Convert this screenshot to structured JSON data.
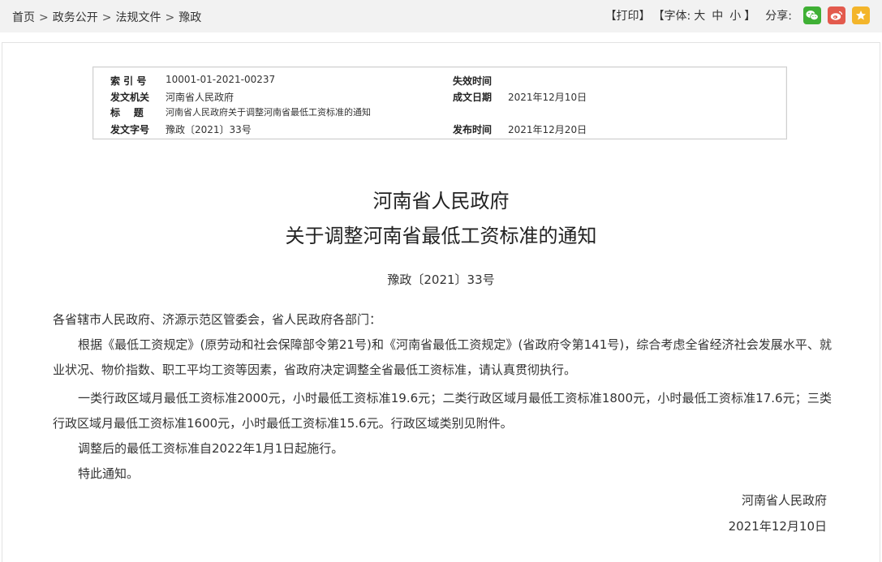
{
  "breadcrumb": {
    "items": [
      "首页",
      "政务公开",
      "法规文件",
      "豫政"
    ],
    "separator": ">"
  },
  "toolbar": {
    "print": "【打印】",
    "font_label": "【字体:",
    "size_large": "大",
    "size_medium": "中",
    "size_small": "小",
    "font_close": "】",
    "share_label": "分享:"
  },
  "share": {
    "icons": [
      "wechat-icon",
      "weibo-icon",
      "favorite-star-icon"
    ],
    "colors": {
      "wechat": "#3fb035",
      "weibo": "#e35a4d",
      "star": "#f3b52b"
    }
  },
  "meta": {
    "index_label": "索 引 号",
    "index_value": "10001-01-2021-00237",
    "issuer_label": "发文机关",
    "issuer_value": "河南省人民政府",
    "subject_label": "标    题",
    "subject_value": "河南省人民政府关于调整河南省最低工资标准的通知",
    "docno_label": "发文字号",
    "docno_value": "豫政〔2021〕33号",
    "expiry_label": "失效时间",
    "expiry_value": "",
    "written_label": "成文日期",
    "written_value": "2021年12月10日",
    "published_label": "发布时间",
    "published_value": "2021年12月20日"
  },
  "document": {
    "title_line1": "河南省人民政府",
    "title_line2": "关于调整河南省最低工资标准的通知",
    "doc_number": "豫政〔2021〕33号",
    "salutation": "各省辖市人民政府、济源示范区管委会，省人民政府各部门：",
    "paragraph1": "根据《最低工资规定》(原劳动和社会保障部令第21号)和《河南省最低工资规定》(省政府令第141号)，综合考虑全省经济社会发展水平、就业状况、物价指数、职工平均工资等因素，省政府决定调整全省最低工资标准，请认真贯彻执行。",
    "paragraph2": "一类行政区域月最低工资标准2000元，小时最低工资标准19.6元；二类行政区域月最低工资标准1800元，小时最低工资标准17.6元；三类行政区域月最低工资标准1600元，小时最低工资标准15.6元。行政区域类别见附件。",
    "paragraph3": "调整后的最低工资标准自2022年1月1日起施行。",
    "paragraph4": "特此通知。",
    "signature": "河南省人民政府",
    "sign_date": "2021年12月10日"
  }
}
